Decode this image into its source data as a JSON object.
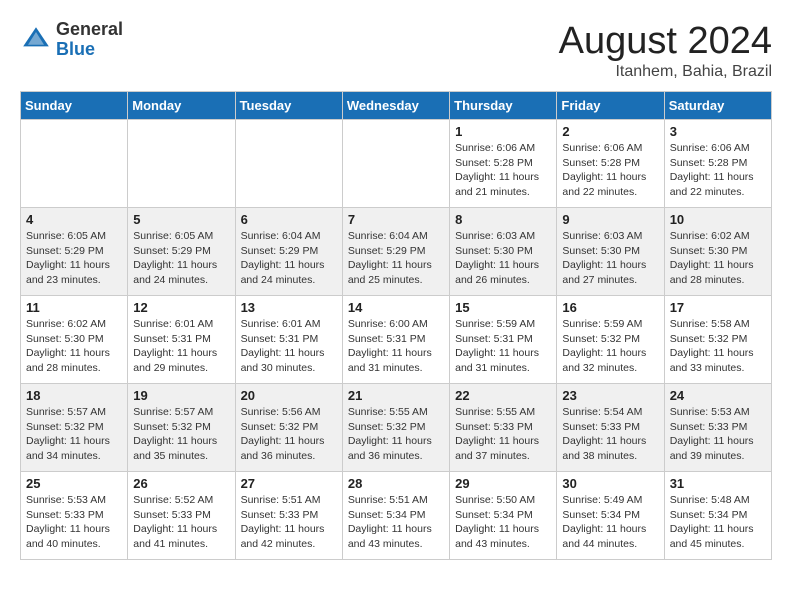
{
  "header": {
    "logo_general": "General",
    "logo_blue": "Blue",
    "month_year": "August 2024",
    "location": "Itanhem, Bahia, Brazil"
  },
  "weekdays": [
    "Sunday",
    "Monday",
    "Tuesday",
    "Wednesday",
    "Thursday",
    "Friday",
    "Saturday"
  ],
  "weeks": [
    [
      {
        "day": "",
        "info": ""
      },
      {
        "day": "",
        "info": ""
      },
      {
        "day": "",
        "info": ""
      },
      {
        "day": "",
        "info": ""
      },
      {
        "day": "1",
        "info": "Sunrise: 6:06 AM\nSunset: 5:28 PM\nDaylight: 11 hours\nand 21 minutes."
      },
      {
        "day": "2",
        "info": "Sunrise: 6:06 AM\nSunset: 5:28 PM\nDaylight: 11 hours\nand 22 minutes."
      },
      {
        "day": "3",
        "info": "Sunrise: 6:06 AM\nSunset: 5:28 PM\nDaylight: 11 hours\nand 22 minutes."
      }
    ],
    [
      {
        "day": "4",
        "info": "Sunrise: 6:05 AM\nSunset: 5:29 PM\nDaylight: 11 hours\nand 23 minutes."
      },
      {
        "day": "5",
        "info": "Sunrise: 6:05 AM\nSunset: 5:29 PM\nDaylight: 11 hours\nand 24 minutes."
      },
      {
        "day": "6",
        "info": "Sunrise: 6:04 AM\nSunset: 5:29 PM\nDaylight: 11 hours\nand 24 minutes."
      },
      {
        "day": "7",
        "info": "Sunrise: 6:04 AM\nSunset: 5:29 PM\nDaylight: 11 hours\nand 25 minutes."
      },
      {
        "day": "8",
        "info": "Sunrise: 6:03 AM\nSunset: 5:30 PM\nDaylight: 11 hours\nand 26 minutes."
      },
      {
        "day": "9",
        "info": "Sunrise: 6:03 AM\nSunset: 5:30 PM\nDaylight: 11 hours\nand 27 minutes."
      },
      {
        "day": "10",
        "info": "Sunrise: 6:02 AM\nSunset: 5:30 PM\nDaylight: 11 hours\nand 28 minutes."
      }
    ],
    [
      {
        "day": "11",
        "info": "Sunrise: 6:02 AM\nSunset: 5:30 PM\nDaylight: 11 hours\nand 28 minutes."
      },
      {
        "day": "12",
        "info": "Sunrise: 6:01 AM\nSunset: 5:31 PM\nDaylight: 11 hours\nand 29 minutes."
      },
      {
        "day": "13",
        "info": "Sunrise: 6:01 AM\nSunset: 5:31 PM\nDaylight: 11 hours\nand 30 minutes."
      },
      {
        "day": "14",
        "info": "Sunrise: 6:00 AM\nSunset: 5:31 PM\nDaylight: 11 hours\nand 31 minutes."
      },
      {
        "day": "15",
        "info": "Sunrise: 5:59 AM\nSunset: 5:31 PM\nDaylight: 11 hours\nand 31 minutes."
      },
      {
        "day": "16",
        "info": "Sunrise: 5:59 AM\nSunset: 5:32 PM\nDaylight: 11 hours\nand 32 minutes."
      },
      {
        "day": "17",
        "info": "Sunrise: 5:58 AM\nSunset: 5:32 PM\nDaylight: 11 hours\nand 33 minutes."
      }
    ],
    [
      {
        "day": "18",
        "info": "Sunrise: 5:57 AM\nSunset: 5:32 PM\nDaylight: 11 hours\nand 34 minutes."
      },
      {
        "day": "19",
        "info": "Sunrise: 5:57 AM\nSunset: 5:32 PM\nDaylight: 11 hours\nand 35 minutes."
      },
      {
        "day": "20",
        "info": "Sunrise: 5:56 AM\nSunset: 5:32 PM\nDaylight: 11 hours\nand 36 minutes."
      },
      {
        "day": "21",
        "info": "Sunrise: 5:55 AM\nSunset: 5:32 PM\nDaylight: 11 hours\nand 36 minutes."
      },
      {
        "day": "22",
        "info": "Sunrise: 5:55 AM\nSunset: 5:33 PM\nDaylight: 11 hours\nand 37 minutes."
      },
      {
        "day": "23",
        "info": "Sunrise: 5:54 AM\nSunset: 5:33 PM\nDaylight: 11 hours\nand 38 minutes."
      },
      {
        "day": "24",
        "info": "Sunrise: 5:53 AM\nSunset: 5:33 PM\nDaylight: 11 hours\nand 39 minutes."
      }
    ],
    [
      {
        "day": "25",
        "info": "Sunrise: 5:53 AM\nSunset: 5:33 PM\nDaylight: 11 hours\nand 40 minutes."
      },
      {
        "day": "26",
        "info": "Sunrise: 5:52 AM\nSunset: 5:33 PM\nDaylight: 11 hours\nand 41 minutes."
      },
      {
        "day": "27",
        "info": "Sunrise: 5:51 AM\nSunset: 5:33 PM\nDaylight: 11 hours\nand 42 minutes."
      },
      {
        "day": "28",
        "info": "Sunrise: 5:51 AM\nSunset: 5:34 PM\nDaylight: 11 hours\nand 43 minutes."
      },
      {
        "day": "29",
        "info": "Sunrise: 5:50 AM\nSunset: 5:34 PM\nDaylight: 11 hours\nand 43 minutes."
      },
      {
        "day": "30",
        "info": "Sunrise: 5:49 AM\nSunset: 5:34 PM\nDaylight: 11 hours\nand 44 minutes."
      },
      {
        "day": "31",
        "info": "Sunrise: 5:48 AM\nSunset: 5:34 PM\nDaylight: 11 hours\nand 45 minutes."
      }
    ]
  ]
}
